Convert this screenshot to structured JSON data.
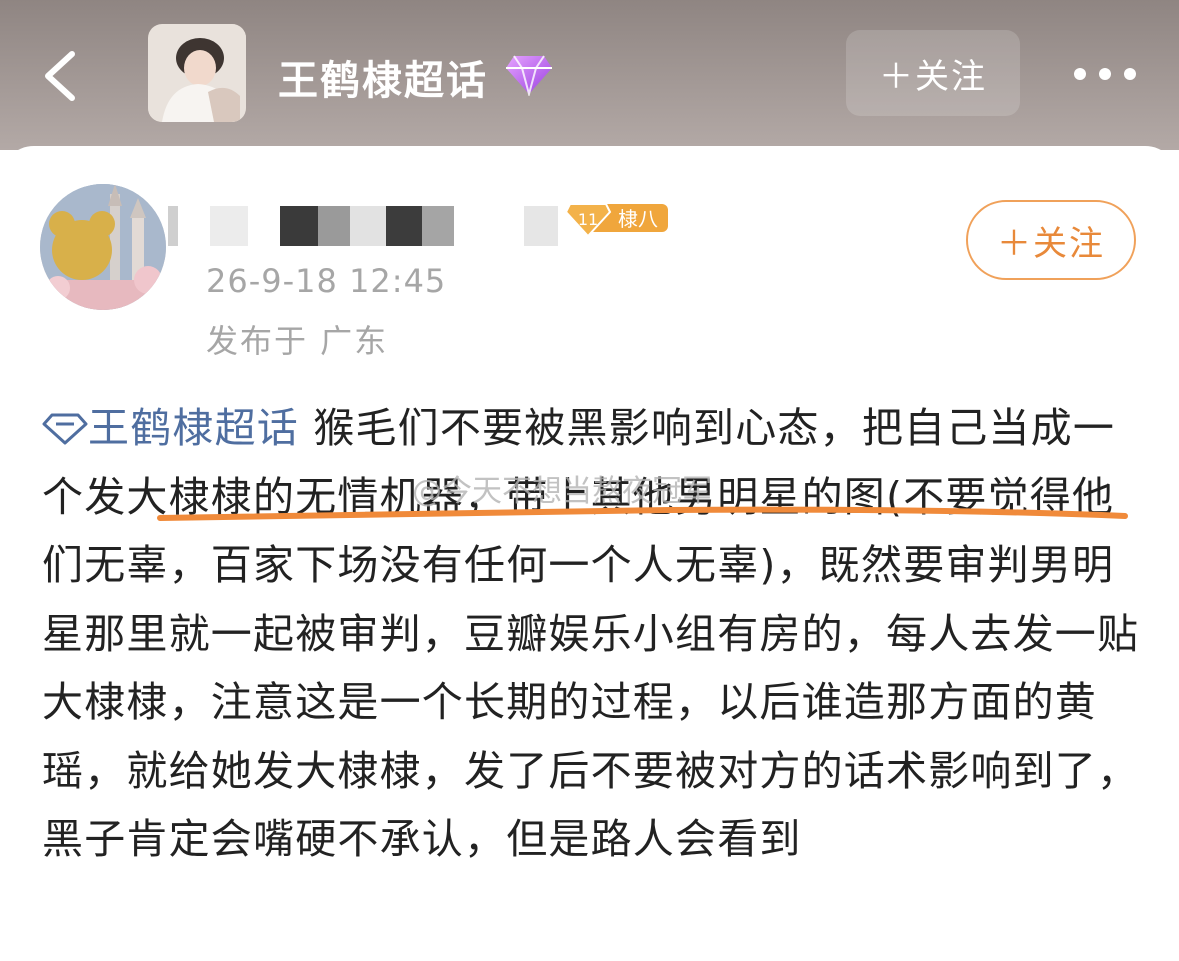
{
  "header": {
    "topic_title": "王鹤棣超话",
    "follow_label": "＋关注"
  },
  "post": {
    "level_badge": {
      "level": "11",
      "name": "棣八"
    },
    "time": "26-9-18 12:45",
    "location": "发布于 广东",
    "follow_label": "＋关注",
    "topic_link": "王鹤棣超话",
    "content_text": "猴毛们不要被黑影响到心态，把自己当成一个发大棣棣的无情机器，带上其他男明星的图(不要觉得他们无辜，百家下场没有任何一个人无辜)，既然要审判男明星那里就一起被审判，豆瓣娱乐小组有房的，每人去发一贴大棣棣，注意这是一个长期的过程，以后谁造那方面的黄瑶，就给她发大棣棣，发了后不要被对方的话术影响到了，黑子肯定会嘴硬不承认，但是路人会看到"
  },
  "watermark": "@今天不想当熬夜冠军",
  "colors": {
    "header_bg": "#9a908d",
    "topic_link": "#4f6ea0",
    "follow_orange": "#e8893a",
    "underline": "#f08a3a",
    "badge_gold": "#f0a63c"
  },
  "icons": [
    "back-arrow-icon",
    "diamond-icon",
    "more-icon",
    "topic-diamond-icon",
    "level-badge-icon"
  ]
}
